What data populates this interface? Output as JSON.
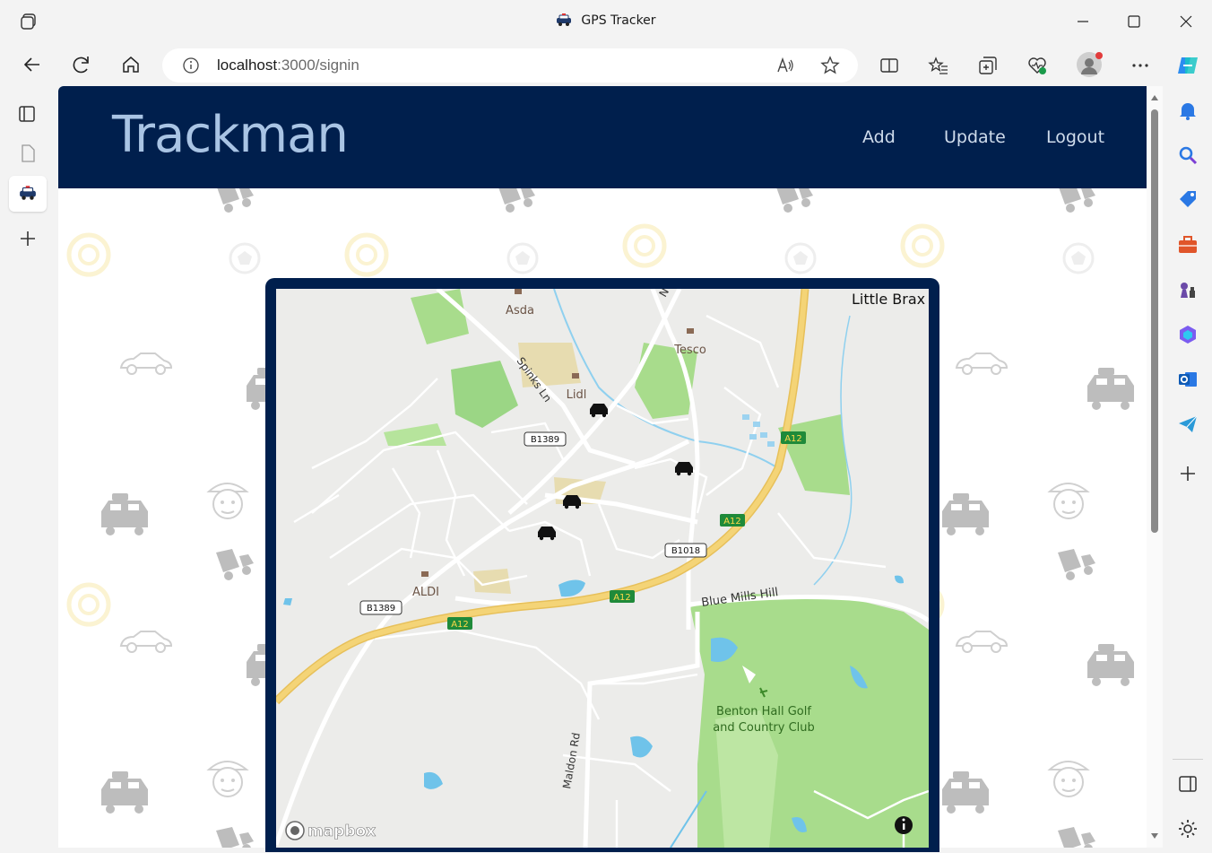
{
  "browser": {
    "window_title": "GPS Tracker",
    "url_host": "localhost",
    "url_rest": ":3000/signin"
  },
  "app": {
    "brand": "Trackman",
    "nav": [
      {
        "label": "Add"
      },
      {
        "label": "Update"
      },
      {
        "label": "Logout"
      }
    ]
  },
  "map": {
    "place_labels": {
      "asda": "Asda",
      "tesco": "Tesco",
      "lidl": "Lidl",
      "aldi": "ALDI",
      "little_braxted": "Little Brax",
      "golf_line1": "Benton Hall Golf",
      "golf_line2": "and Country Club"
    },
    "road_labels": {
      "spinks_ln": "Spinks Ln",
      "blue_mills_hill": "Blue Mills Hill",
      "maldon_rd": "Maldon Rd",
      "north_partial": "N"
    },
    "shields": {
      "b1389_top": "B1389",
      "b1389_bottom": "B1389",
      "b1018": "B1018",
      "a12_1": "A12",
      "a12_2": "A12",
      "a12_3": "A12",
      "a12_4": "A12"
    },
    "attribution": "mapbox",
    "vehicles": 4
  },
  "colors": {
    "header_bg": "#001f4d",
    "brand_text": "#a9c4e4",
    "map_bg": "#ececea",
    "park": "#a8dc8c",
    "water": "#6fc3ea",
    "motorway": "#f1c95f",
    "shield_green": "#1f8a3a"
  }
}
